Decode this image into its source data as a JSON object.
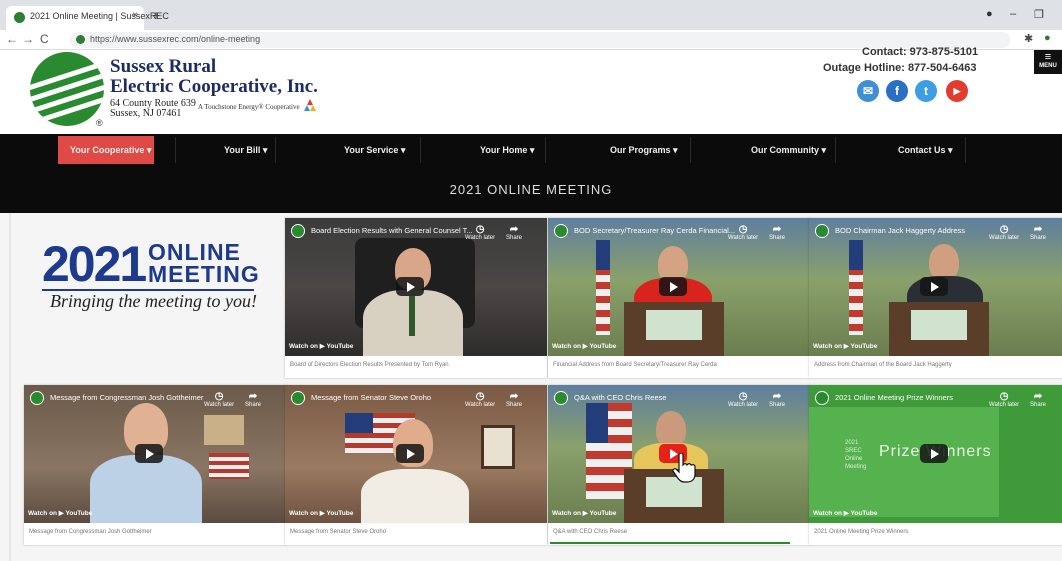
{
  "browser": {
    "tab_title": "2021 Online Meeting | SussexREC",
    "tab_close": "×",
    "new_tab": "+",
    "url": "https://www.sussexrec.com/online-meeting",
    "back": "←",
    "forward": "→",
    "reload": "C",
    "minimize": "–",
    "restore": "❐",
    "account": "●",
    "extensions": "✱"
  },
  "header": {
    "org_line1": "Sussex Rural",
    "org_line2": "Electric Cooperative, Inc.",
    "address_line1": "64 County Route 639",
    "address_line2": "Sussex, NJ 07461",
    "touchstone": "A Touchstone Energy® Cooperative",
    "registered": "®",
    "contact": "Contact: 973-875-5101",
    "hotline": "Outage Hotline: 877-504-6463",
    "menu_label": "MENU",
    "social": [
      {
        "icon": "email-icon",
        "glyph": "✉",
        "color": "#3d8fd6"
      },
      {
        "icon": "facebook-icon",
        "glyph": "f",
        "color": "#2a6fc4"
      },
      {
        "icon": "twitter-icon",
        "glyph": "t",
        "color": "#3d9ee3"
      },
      {
        "icon": "youtube-icon",
        "glyph": "▶",
        "color": "#e23b2f"
      }
    ]
  },
  "nav": {
    "items": [
      {
        "label": "Your Cooperative ▾"
      },
      {
        "label": "Your Bill ▾"
      },
      {
        "label": "Your Service ▾"
      },
      {
        "label": "Your Home ▾"
      },
      {
        "label": "Our Programs ▾"
      },
      {
        "label": "Our Community ▾"
      },
      {
        "label": "Contact Us ▾"
      }
    ],
    "active_color": "#e04a46"
  },
  "page_title": "2021 ONLINE MEETING",
  "hero": {
    "year": "2021",
    "word1": "ONLINE",
    "word2": "MEETING",
    "tagline": "Bringing the meeting to you!"
  },
  "videos": [
    {
      "title": "Board Election Results with General Counsel T...",
      "caption": "Board of Directors Election Results Presented by Tom Ryan",
      "watch_later": "Watch later",
      "share": "Share",
      "watch_on": "Watch on ▶ YouTube"
    },
    {
      "title": "BOD Secretary/Treasurer Ray Cerda Financial...",
      "caption": "Financial Address from Board Secretary/Treasurer Ray Cerda",
      "watch_later": "Watch later",
      "share": "Share",
      "watch_on": "Watch on ▶ YouTube"
    },
    {
      "title": "BOD Chairman Jack Haggerty Address",
      "caption": "Address from Chairman of the Board Jack Haggerty",
      "watch_later": "Watch later",
      "share": "Share",
      "watch_on": "Watch on ▶ YouTube"
    },
    {
      "title": "Message from Congressman Josh Gottheimer",
      "caption": "Message from Congressman Josh Gottheimer",
      "watch_later": "Watch later",
      "share": "Share",
      "watch_on": "Watch on ▶ YouTube"
    },
    {
      "title": "Message from Senator Steve Oroho",
      "caption": "Message from Senator Steve Oroho",
      "watch_later": "Watch later",
      "share": "Share",
      "watch_on": "Watch on ▶ YouTube"
    },
    {
      "title": "Q&A with CEO Chris Reese",
      "caption": "Q&A with CEO Chris Reese",
      "watch_later": "Watch later",
      "share": "Share",
      "watch_on": "Watch on ▶ YouTube"
    },
    {
      "title": "2021 Online Meeting Prize Winners",
      "caption": "2021 Online Meeting Prize Winners",
      "watch_later": "Watch later",
      "share": "Share",
      "watch_on": "Watch on ▶ YouTube",
      "thumb_text": "Prize Winners",
      "thumb_small1": "2021",
      "thumb_small2": "SREC",
      "thumb_small3": "Online",
      "thumb_small4": "Meeting"
    }
  ]
}
